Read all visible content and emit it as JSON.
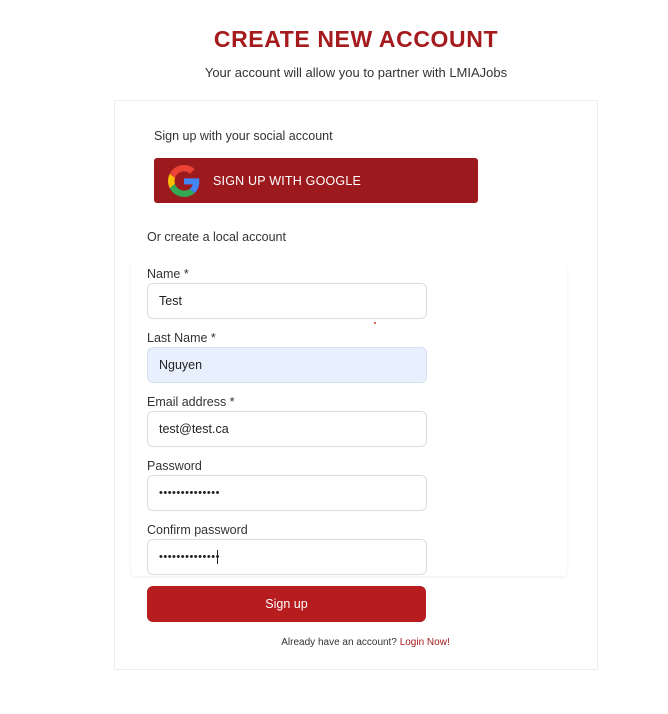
{
  "header": {
    "title": "CREATE NEW ACCOUNT",
    "subtitle": "Your account will allow you to partner with LMIAJobs"
  },
  "social": {
    "label": "Sign up with your social account",
    "google_button": "SIGN UP WITH GOOGLE",
    "google_icon": "google-g-icon"
  },
  "local": {
    "label": "Or create a local account"
  },
  "form": {
    "name_label": "Name *",
    "name_value": "Test",
    "last_name_label": "Last Name *",
    "last_name_value": "Nguyen",
    "email_label": "Email address *",
    "email_value": "test@test.ca",
    "password_label": "Password",
    "password_value": "••••••••••••••",
    "confirm_label": "Confirm password",
    "confirm_value": "••••••••••••••",
    "submit_label": "Sign up"
  },
  "footer": {
    "prompt": "Already have an account?",
    "login_link": "Login Now!"
  },
  "colors": {
    "brand_red": "#a51a1d",
    "button_red": "#b71c1f",
    "autofill_blue": "#e8f0fe"
  }
}
